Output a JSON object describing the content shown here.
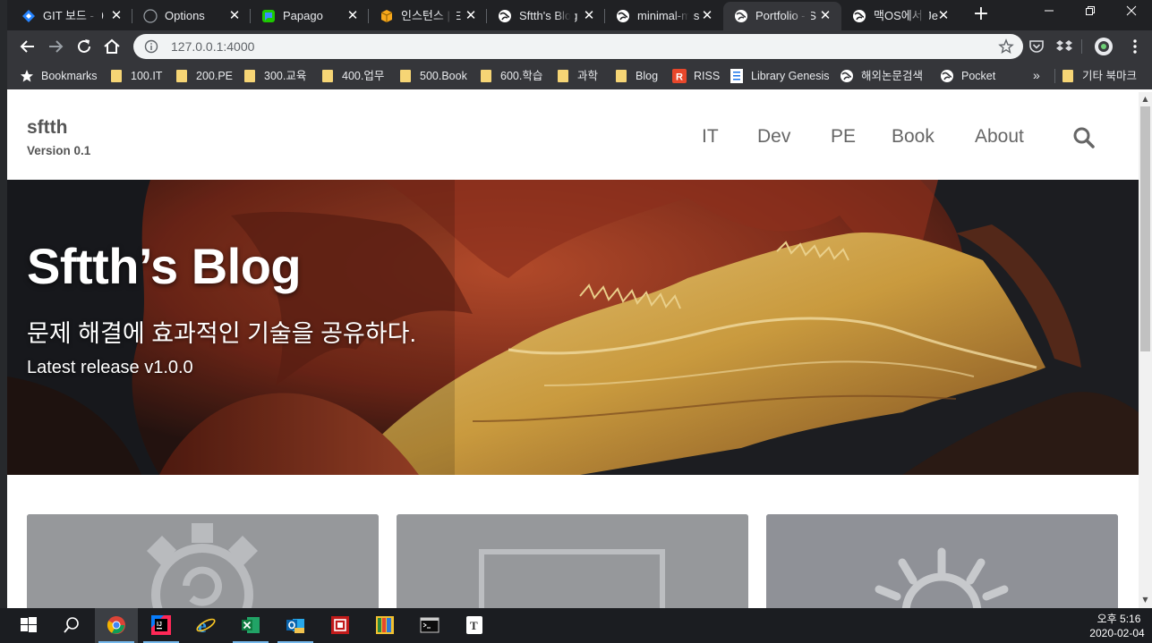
{
  "browser": {
    "tabs": [
      {
        "title": "GIT 보드 - 0",
        "active": false
      },
      {
        "title": "Options",
        "active": false
      },
      {
        "title": "Papago",
        "active": false
      },
      {
        "title": "인스턴스 | E",
        "active": false
      },
      {
        "title": "Sftth's Blog",
        "active": false
      },
      {
        "title": "minimal-mis",
        "active": false
      },
      {
        "title": "Portfolio - S",
        "active": true
      },
      {
        "title": "맥OS에서 Je",
        "active": false
      }
    ],
    "new_tab": "+",
    "url": "127.0.0.1:4000",
    "bookmarks": [
      {
        "label": "Bookmarks",
        "icon": "star-icon"
      },
      {
        "label": "100.IT",
        "icon": "folder-icon"
      },
      {
        "label": "200.PE",
        "icon": "folder-icon"
      },
      {
        "label": "300.교육",
        "icon": "folder-icon"
      },
      {
        "label": "400.업무",
        "icon": "folder-icon"
      },
      {
        "label": "500.Book",
        "icon": "folder-icon"
      },
      {
        "label": "600.학습",
        "icon": "folder-icon"
      },
      {
        "label": "과학",
        "icon": "folder-icon"
      },
      {
        "label": "Blog",
        "icon": "folder-icon"
      },
      {
        "label": "RISS",
        "icon": "riss-icon"
      },
      {
        "label": "Library Genesis",
        "icon": "library-icon"
      },
      {
        "label": "해외논문검색",
        "icon": "globe-icon"
      },
      {
        "label": "Pocket",
        "icon": "globe-icon"
      }
    ],
    "bookmarks_more": "»",
    "other_bookmarks": "기타 북마크"
  },
  "site": {
    "title": "sftth",
    "subtitle": "Version 0.1",
    "nav": [
      "IT",
      "Dev",
      "PE",
      "Book",
      "About"
    ]
  },
  "hero": {
    "title": "Sftth’s Blog",
    "subtitle": "문제 해결에 효과적인 기술을 공유하다.",
    "release": "Latest release v1.0.0"
  },
  "cards": [
    {
      "icon": "gear-icon"
    },
    {
      "icon": "monitor-icon"
    },
    {
      "icon": "lightbulb-icon"
    }
  ],
  "taskbar": {
    "apps": [
      "start-button",
      "search-icon",
      "chrome-icon",
      "intellij-icon",
      "internet-explorer-icon",
      "excel-icon",
      "outlook-icon",
      "app-red-icon",
      "app-colorful-icon",
      "terminal-icon",
      "typora-icon"
    ],
    "time": "오후 5:16",
    "date": "2020-02-04"
  },
  "colors": {
    "tabstrip": "#202124",
    "toolbar": "#35363a",
    "hero_dark": "#1c1d21",
    "card": "#96989b",
    "nav_text": "#666666"
  }
}
